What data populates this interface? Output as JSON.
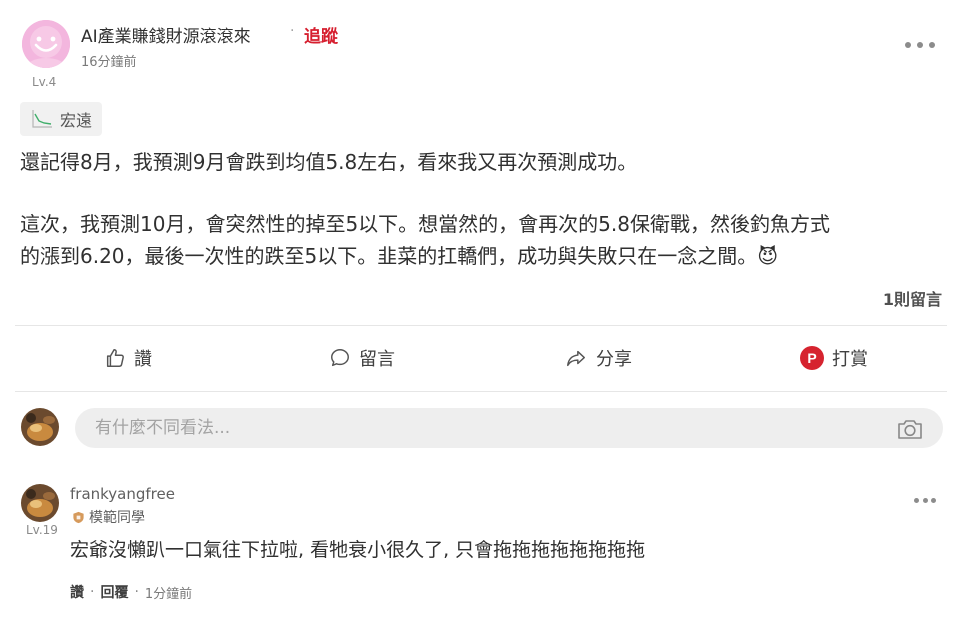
{
  "post": {
    "author": "AI產業賺錢財源滾滾來",
    "separator": "·",
    "follow_label": "追蹤",
    "time": "16分鐘前",
    "level": "Lv.4",
    "stock_tag": "宏遠",
    "body_lines": [
      "還記得8月，我預測9月會跌到均值5.8左右，看來我又再次預測成功。",
      "這次，我預測10月，會突然性的掉至5以下。想當然的，會再次的5.8保衛戰，然後釣魚方式",
      "的漲到6.20，最後一次性的跌至5以下。韭菜的扛轎們，成功與失敗只在一念之間。😈"
    ],
    "comment_count": "1則留言"
  },
  "actions": {
    "like": "讚",
    "comment": "留言",
    "share": "分享",
    "tip": "打賞",
    "tip_icon_letter": "P"
  },
  "composer": {
    "placeholder": "有什麼不同看法..."
  },
  "comment": {
    "author": "frankyangfree",
    "level": "Lv.19",
    "badge": "模範同學",
    "text": "宏爺沒懶趴一口氣往下拉啦, 看牠衰小很久了, 只會拖拖拖拖拖拖拖拖",
    "like_label": "讚",
    "separator": "·",
    "reply_label": "回覆",
    "time": "1分鐘前"
  },
  "colors": {
    "follow": "#d61f2f",
    "tip_icon": "#d6232f",
    "avatar_pink": "#f3b6de",
    "stock_line": "#3fae6a"
  }
}
